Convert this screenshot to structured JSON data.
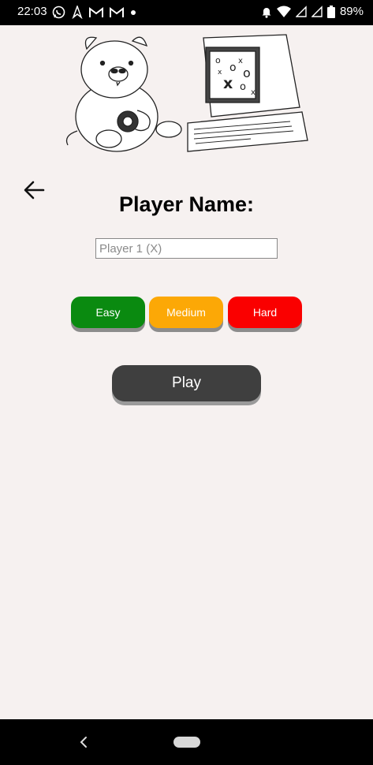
{
  "status_bar": {
    "time": "22:03",
    "battery_percent": "89%",
    "left_icons": [
      "whatsapp-icon",
      "flame-icon",
      "gmail-icon",
      "gmail-icon",
      "dot-icon"
    ],
    "right_icons": [
      "alarm-icon",
      "wifi-icon",
      "signal-icon",
      "signal-icon",
      "battery-icon"
    ]
  },
  "header": {
    "illustration": "wombat-and-computer-tic-tac-toe"
  },
  "form": {
    "title": "Player Name:",
    "name_placeholder": "Player 1 (X)",
    "name_value": ""
  },
  "difficulty": {
    "easy_label": "Easy",
    "medium_label": "Medium",
    "hard_label": "Hard",
    "colors": {
      "easy": "#0a8a10",
      "medium": "#fca806",
      "hard": "#fa0000"
    }
  },
  "actions": {
    "play_label": "Play"
  },
  "colors": {
    "background": "#f6f1f0",
    "play_button": "#3f3f3f"
  }
}
